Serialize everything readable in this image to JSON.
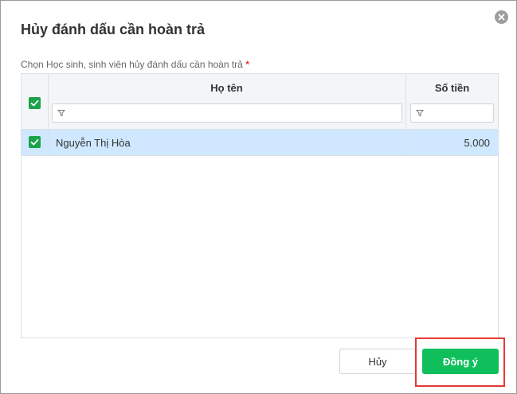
{
  "dialog": {
    "title": "Hủy đánh dấu cần hoàn trả",
    "field_label": "Chọn Học sinh, sinh viên hủy đánh dấu cần hoàn trả",
    "required_mark": "*"
  },
  "grid": {
    "columns": [
      {
        "key": "name",
        "label": "Họ tên"
      },
      {
        "key": "amount",
        "label": "Số tiền"
      }
    ],
    "filters": {
      "name": "",
      "amount": ""
    },
    "header_checked": true,
    "rows": [
      {
        "checked": true,
        "name": "Nguyễn Thị Hòa",
        "amount": "5.000"
      }
    ]
  },
  "buttons": {
    "cancel": "Hủy",
    "ok": "Đồng ý"
  },
  "colors": {
    "accent_green": "#0fbf5c",
    "checkbox_green": "#1aa34a",
    "selected_row": "#cfe8ff",
    "highlight_red": "#e53935",
    "close_gray": "#9e9e9e"
  },
  "icons": {
    "close": "close-circle-icon",
    "filter": "filter-icon",
    "check": "checkmark-icon"
  }
}
